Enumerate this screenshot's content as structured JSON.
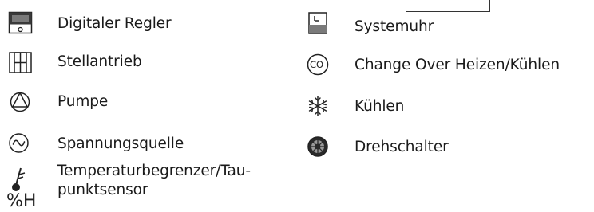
{
  "legend": {
    "left": [
      {
        "icon": "digital-controller-icon",
        "label": "Digitaler Regler"
      },
      {
        "icon": "actuator-icon",
        "label": "Stellantrieb"
      },
      {
        "icon": "pump-icon",
        "label": "Pumpe"
      },
      {
        "icon": "voltage-source-icon",
        "label": "Spannungsquelle"
      },
      {
        "icon": "temperature-humidity-icon",
        "icon_text": "%H",
        "label_line1": "Temperaturbegrenzer/Tau-",
        "label_line2": "punktsensor"
      }
    ],
    "right": [
      {
        "icon": "system-clock-icon",
        "label": "Systemuhr"
      },
      {
        "icon": "change-over-icon",
        "icon_text": "CO",
        "label": "Change Over Heizen/Kühlen"
      },
      {
        "icon": "snowflake-icon",
        "label": "Kühlen"
      },
      {
        "icon": "rotary-switch-icon",
        "label": "Drehschalter"
      }
    ]
  }
}
